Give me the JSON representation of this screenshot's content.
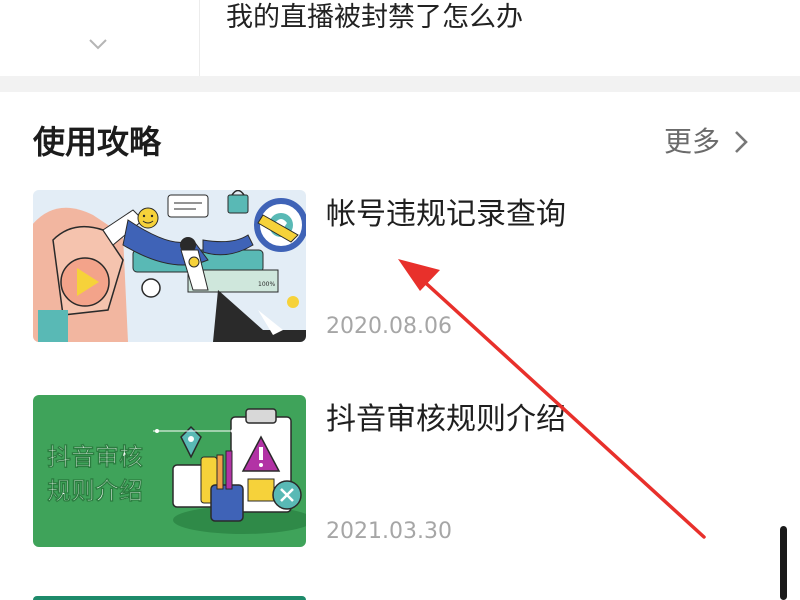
{
  "faq": {
    "question": "我的直播被封禁了怎么办"
  },
  "section": {
    "title": "使用攻略",
    "more_label": "更多"
  },
  "articles": [
    {
      "title": "帐号违规记录查询",
      "date": "2020.08.06"
    },
    {
      "title": "抖音审核规则介绍",
      "date": "2021.03.30",
      "thumb_text_line1": "抖音审核",
      "thumb_text_line2": "规则介绍"
    }
  ],
  "colors": {
    "accent_green": "#3fa35a",
    "annotation_red": "#e8302b",
    "date_gray": "#a6a6a6"
  }
}
